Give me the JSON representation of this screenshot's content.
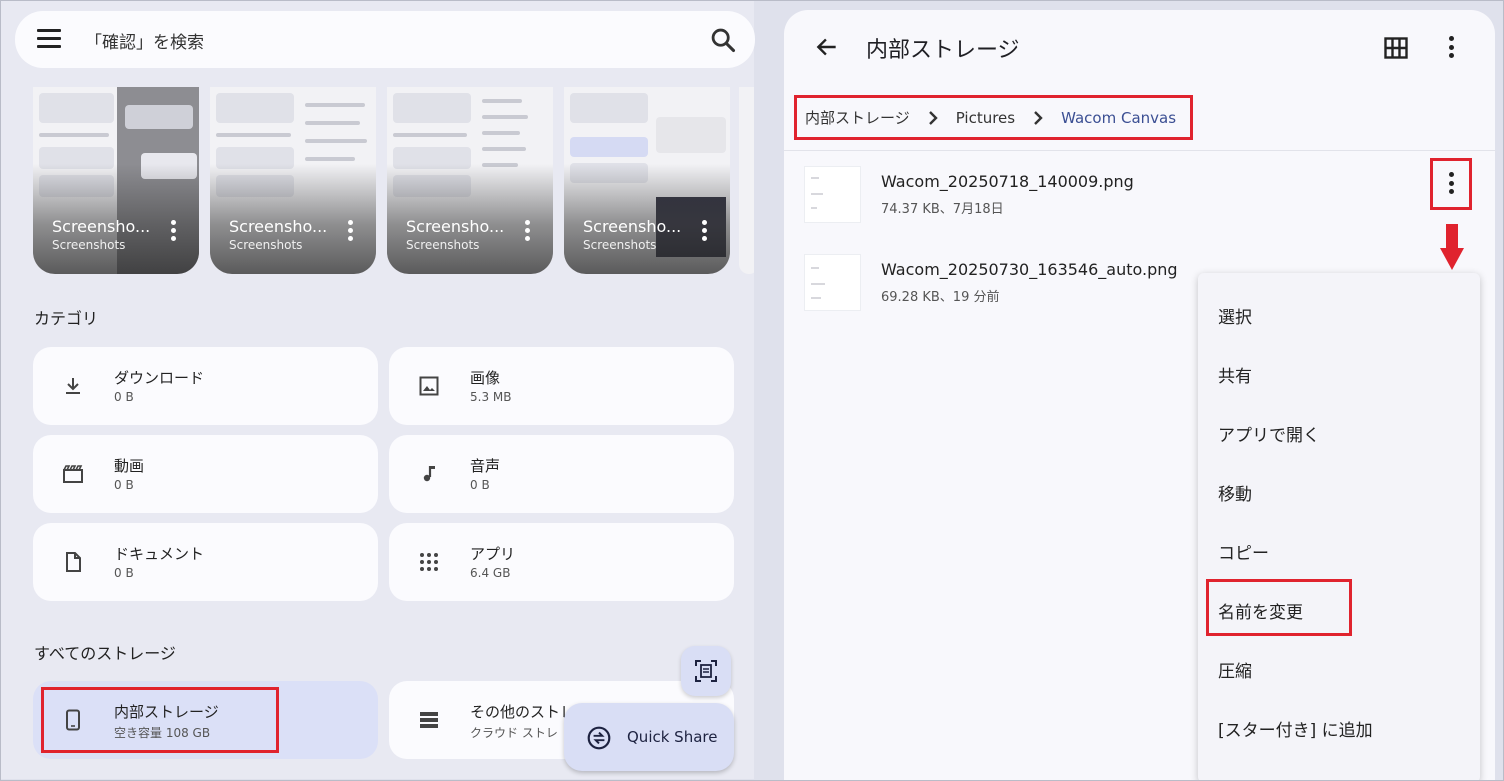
{
  "search": {
    "placeholder": "「確認」を検索"
  },
  "recent": [
    {
      "name": "Screensho...",
      "folder": "Screenshots"
    },
    {
      "name": "Screensho...",
      "folder": "Screenshots"
    },
    {
      "name": "Screensho...",
      "folder": "Screenshots"
    },
    {
      "name": "Screensho...",
      "folder": "Screenshots"
    }
  ],
  "categories": {
    "title": "カテゴリ",
    "items": [
      {
        "label": "ダウンロード",
        "size": "0 B",
        "icon": "download-icon"
      },
      {
        "label": "画像",
        "size": "5.3 MB",
        "icon": "image-icon"
      },
      {
        "label": "動画",
        "size": "0 B",
        "icon": "video-icon"
      },
      {
        "label": "音声",
        "size": "0 B",
        "icon": "music-note-icon"
      },
      {
        "label": "ドキュメント",
        "size": "0 B",
        "icon": "document-icon"
      },
      {
        "label": "アプリ",
        "size": "6.4 GB",
        "icon": "apps-grid-icon"
      }
    ]
  },
  "storage": {
    "title": "すべてのストレージ",
    "items": [
      {
        "label": "内部ストレージ",
        "sub": "空き容量 108 GB",
        "icon": "phone-icon"
      },
      {
        "label": "その他のストレ",
        "sub": "クラウド ストレ",
        "icon": "storage-stack-icon"
      }
    ]
  },
  "quick_share": {
    "label": "Quick Share"
  },
  "right": {
    "title": "内部ストレージ",
    "breadcrumbs": [
      "内部ストレージ",
      "Pictures",
      "Wacom Canvas"
    ],
    "files": [
      {
        "name": "Wacom_20250718_140009.png",
        "meta": "74.37 KB、7月18日"
      },
      {
        "name": "Wacom_20250730_163546_auto.png",
        "meta": "69.28 KB、19 分前"
      }
    ],
    "context_menu": [
      "選択",
      "共有",
      "アプリで開く",
      "移動",
      "コピー",
      "名前を変更",
      "圧縮",
      "[スター付き] に追加"
    ]
  },
  "colors": {
    "highlight": "#e0232e",
    "accent": "#3b4f93",
    "selected_card": "#dbe0f7"
  }
}
